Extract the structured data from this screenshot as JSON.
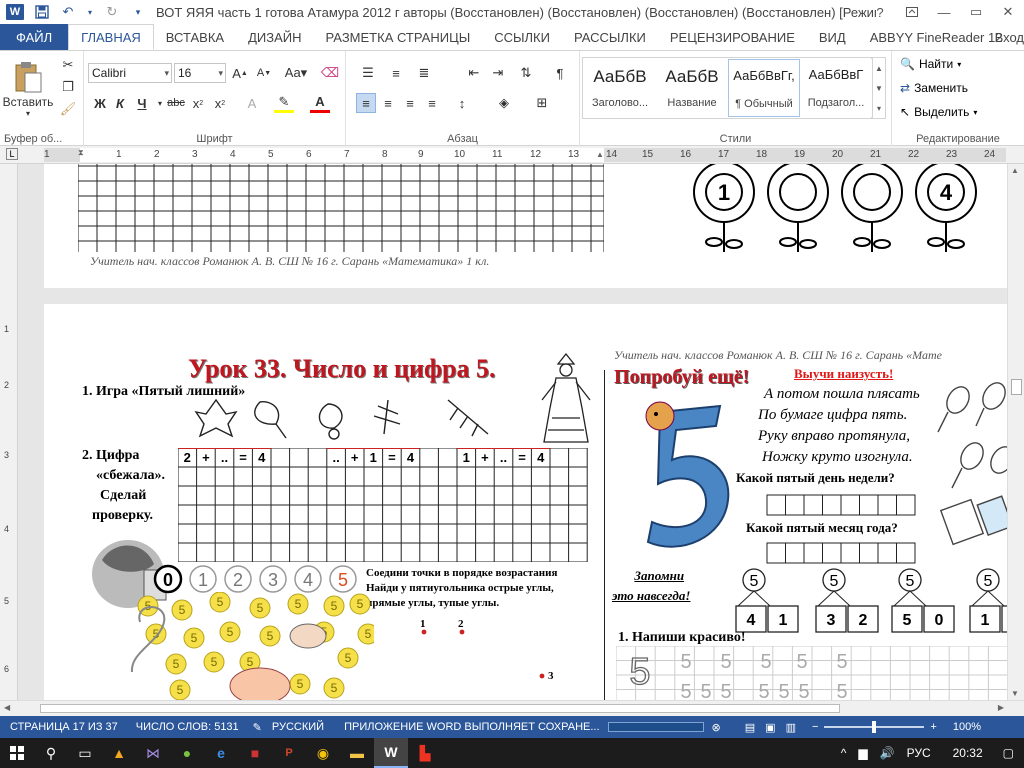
{
  "window": {
    "title": "ВОТ  ЯЯЯ часть 1 готова Атамура 2012 г авторы (Восстановлен) (Восстановлен) (Восстановлен) (Восстановлен) [Режим ограни...",
    "controls": [
      "?",
      "—",
      "▭",
      "✕"
    ]
  },
  "tabs": [
    "ФАЙЛ",
    "ГЛАВНАЯ",
    "ВСТАВКА",
    "ДИЗАЙН",
    "РАЗМЕТКА СТРАНИЦЫ",
    "ССЫЛКИ",
    "РАССЫЛКИ",
    "РЕЦЕНЗИРОВАНИЕ",
    "ВИД",
    "ABBYY FineReader 12"
  ],
  "login": "Вход",
  "ribbon": {
    "clipboard": {
      "paste": "Вставить",
      "label": "Буфер об..."
    },
    "font": {
      "name": "Calibri",
      "size": "16",
      "label": "Шрифт"
    },
    "paragraph": {
      "label": "Абзац"
    },
    "styles": {
      "label": "Стили",
      "items": [
        {
          "sample": "АаБбВ",
          "name": "Заголово..."
        },
        {
          "sample": "АаБбВ",
          "name": "Название"
        },
        {
          "sample": "АаБбВвГг,",
          "name": "¶ Обычный"
        },
        {
          "sample": "АаБбВвГ",
          "name": "Подзагол..."
        }
      ]
    },
    "editing": {
      "label": "Редактирование",
      "find": "Найти",
      "replace": "Заменить",
      "select": "Выделить"
    }
  },
  "ruler": {
    "numbers": [
      "1",
      "1",
      "2",
      "3",
      "4",
      "5",
      "6",
      "7",
      "8",
      "9",
      "10",
      "11",
      "12",
      "13",
      "14",
      "15",
      "16",
      "17",
      "18",
      "19",
      "20",
      "21",
      "22",
      "23",
      "24"
    ]
  },
  "vruler": {
    "numbers": [
      "1",
      "2",
      "3",
      "4",
      "5",
      "6"
    ]
  },
  "page1": {
    "footer": "Учитель нач. классов Романюк А. В. СШ № 16 г. Сарань  «Математика» 1 кл.",
    "flower_numbers": [
      "1",
      "",
      "",
      "4"
    ]
  },
  "page2": {
    "header_right": "Учитель нач. классов Романюк А. В. СШ № 16 г. Сарань  «Мате",
    "lesson_title": "Урок 33. Число и цифра 5.",
    "task1": "1. Игра «Пятый лишний»",
    "task2_line1": "2.   Цифра",
    "task2_line2": "«сбежала».",
    "task2_line3": "Сделай",
    "task2_line4": "проверку.",
    "equations": [
      [
        "2",
        "+",
        "..",
        "=",
        "4"
      ],
      [
        "..",
        "+",
        "1",
        "=",
        "4"
      ],
      [
        "1",
        "+",
        "..",
        "=",
        "4"
      ]
    ],
    "circles": [
      "0",
      "1",
      "2",
      "3",
      "4",
      "5"
    ],
    "connect_text": "Соедини точки в порядке возрастания\nНайди у пятиугольника острые углы,\nпрямые углы, тупые углы.",
    "dots": [
      "1",
      "2",
      "3"
    ],
    "try_again": "Попробуй ещё!",
    "learn_heading": "Выучи наизусть!",
    "poem": [
      "А потом пошла плясать",
      "По бумаге цифра пять.",
      "Руку вправо протянула,",
      "Ножку круто изогнула."
    ],
    "q1": "Какой пятый день недели?",
    "q2": "Какой пятый месяц  года?",
    "remember": [
      "Запомни",
      "это навсегда!"
    ],
    "splits": [
      [
        "4",
        "1"
      ],
      [
        "3",
        "2"
      ],
      [
        "5",
        "0"
      ],
      [
        "1",
        "4"
      ]
    ],
    "write_beautiful": "1. Напиши красиво!",
    "fives": "5",
    "big_five": "5"
  },
  "status": {
    "page": "СТРАНИЦА 17 ИЗ 37",
    "words": "ЧИСЛО СЛОВ: 5131",
    "lang": "РУССКИЙ",
    "saving": "ПРИЛОЖЕНИЕ WORD ВЫПОЛНЯЕТ СОХРАНЕ...",
    "zoom": "100%"
  },
  "taskbar": {
    "lang": "РУС",
    "time": "20:32"
  }
}
